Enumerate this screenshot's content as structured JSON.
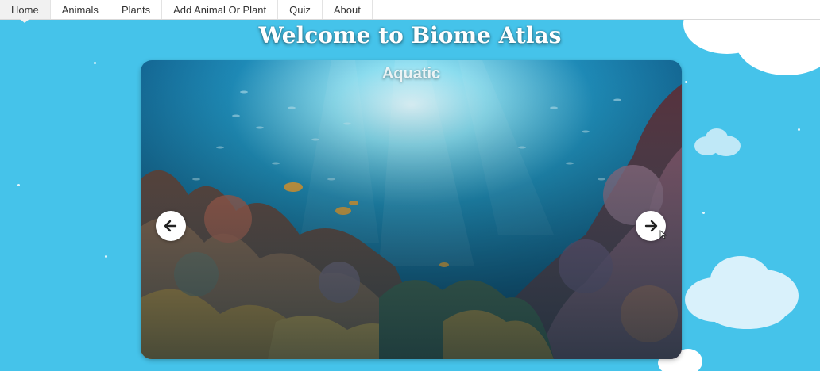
{
  "nav": {
    "items": [
      {
        "label": "Home",
        "active": true
      },
      {
        "label": "Animals",
        "active": false
      },
      {
        "label": "Plants",
        "active": false
      },
      {
        "label": "Add Animal Or Plant",
        "active": false
      },
      {
        "label": "Quiz",
        "active": false
      },
      {
        "label": "About",
        "active": false
      }
    ]
  },
  "hero": {
    "title": "Welcome to Biome Atlas"
  },
  "carousel": {
    "current_slide": "Aquatic",
    "prev_icon": "arrow-left-icon",
    "next_icon": "arrow-right-icon"
  },
  "colors": {
    "sky": "#45c3ea",
    "cloud": "#ffffff",
    "cloud_soft": "#d9f1fb",
    "nav_bg": "#ffffff",
    "nav_active": "#f1f1f1"
  }
}
